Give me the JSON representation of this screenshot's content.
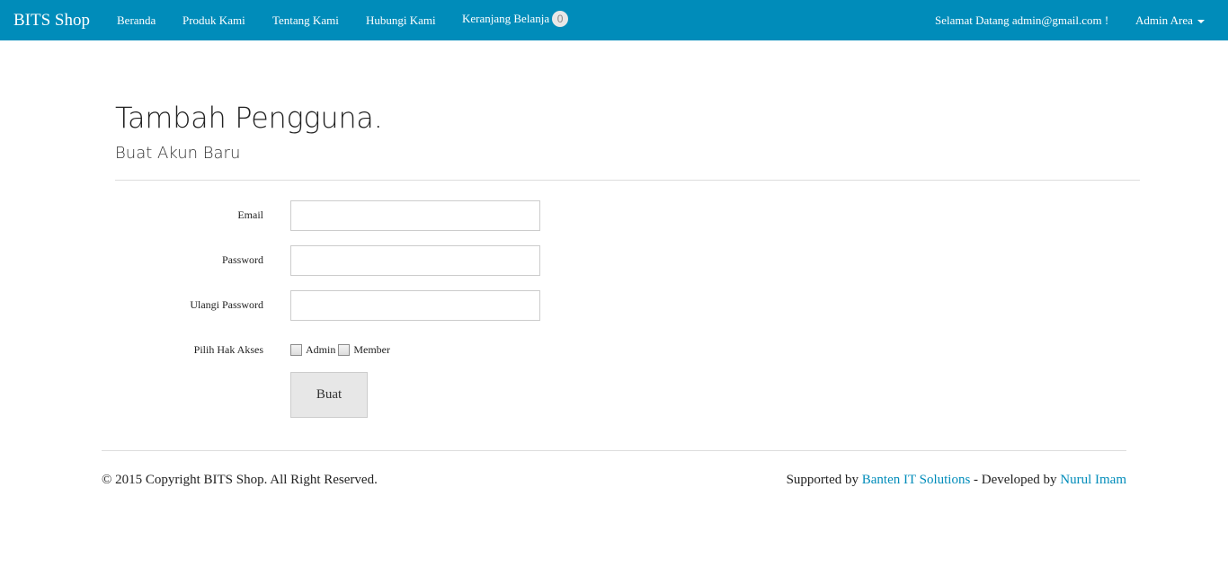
{
  "navbar": {
    "brand": "BITS Shop",
    "items": [
      {
        "label": "Beranda"
      },
      {
        "label": "Produk Kami"
      },
      {
        "label": "Tentang Kami"
      },
      {
        "label": "Hubungi Kami"
      },
      {
        "label": "Keranjang Belanja"
      }
    ],
    "cart_count": "0",
    "welcome": "Selamat Datang admin@gmail.com !",
    "admin_menu": "Admin Area",
    "background_color": "#008cba"
  },
  "page": {
    "title": "Tambah Pengguna.",
    "subtitle": "Buat Akun Baru"
  },
  "form": {
    "email_label": "Email",
    "email_value": "",
    "password_label": "Password",
    "password_value": "",
    "repeat_password_label": "Ulangi Password",
    "repeat_password_value": "",
    "access_label": "Pilih Hak Akses",
    "access_options": [
      {
        "label": "Admin",
        "checked": false
      },
      {
        "label": "Member",
        "checked": false
      }
    ],
    "submit_label": "Buat"
  },
  "footer": {
    "copyright": "© 2015 Copyright BITS Shop. All Right Reserved.",
    "supported_prefix": "Supported by ",
    "supported_link": "Banten IT Solutions",
    "developed_prefix": " - Developed by ",
    "developer_link": "Nurul Imam",
    "link_color": "#008cba"
  }
}
